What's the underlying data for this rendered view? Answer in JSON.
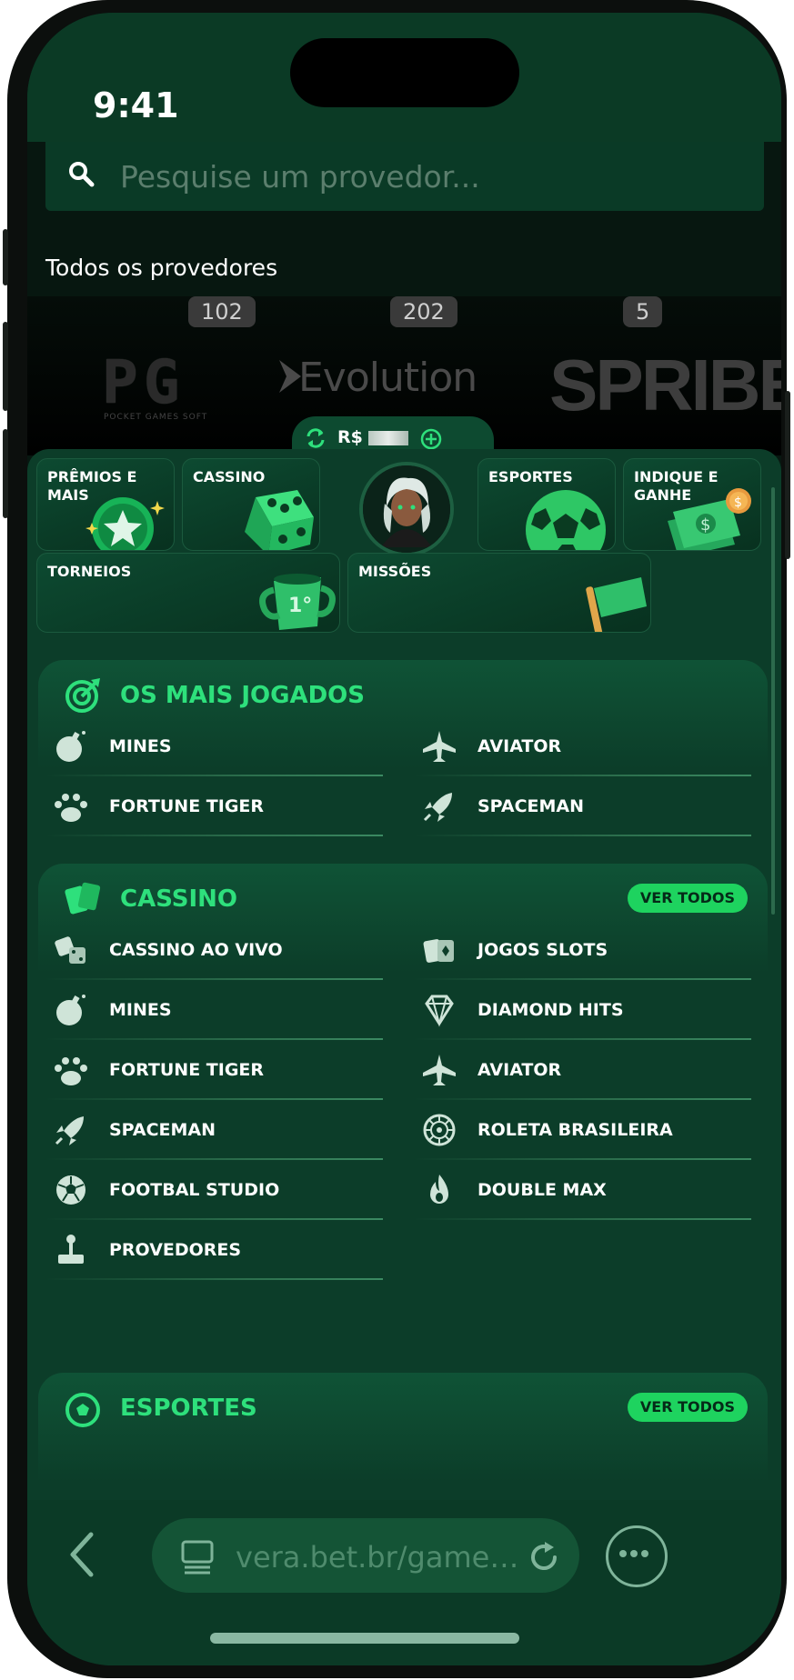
{
  "status_bar": {
    "time": "9:41"
  },
  "search": {
    "placeholder": "Pesquise um provedor..."
  },
  "providers": {
    "title": "Todos os provedores",
    "items": [
      {
        "name": "PG",
        "subtitle": "POCKET GAMES SOFT",
        "count": "102"
      },
      {
        "name": "Evolution",
        "count": "202"
      },
      {
        "name": "SPRIBE",
        "count": "5"
      }
    ]
  },
  "balance": {
    "currency": "R$"
  },
  "quick_tiles": [
    {
      "label": "PRÊMIOS E MAIS"
    },
    {
      "label": "CASSINO"
    },
    {
      "label": "ESPORTES"
    },
    {
      "label": "INDIQUE E GANHE"
    },
    {
      "label": "TORNEIOS"
    },
    {
      "label": "MISSÕES"
    }
  ],
  "sections": {
    "most_played": {
      "title": "OS MAIS JOGADOS",
      "items": [
        {
          "label": "MINES",
          "icon": "bomb-icon"
        },
        {
          "label": "AVIATOR",
          "icon": "airplane-icon"
        },
        {
          "label": "FORTUNE TIGER",
          "icon": "paw-icon"
        },
        {
          "label": "SPACEMAN",
          "icon": "rocket-icon"
        }
      ]
    },
    "cassino": {
      "title": "CASSINO",
      "see_all": "VER TODOS",
      "items": [
        {
          "label": "CASSINO AO VIVO",
          "icon": "dice-icon"
        },
        {
          "label": "JOGOS SLOTS",
          "icon": "cards-icon"
        },
        {
          "label": "MINES",
          "icon": "bomb-icon"
        },
        {
          "label": "DIAMOND HITS",
          "icon": "diamond-icon"
        },
        {
          "label": "FORTUNE TIGER",
          "icon": "paw-icon"
        },
        {
          "label": "AVIATOR",
          "icon": "airplane-icon"
        },
        {
          "label": "SPACEMAN",
          "icon": "rocket-icon"
        },
        {
          "label": "ROLETA BRASILEIRA",
          "icon": "roulette-icon"
        },
        {
          "label": "FOOTBAL STUDIO",
          "icon": "soccer-ball-icon"
        },
        {
          "label": "DOUBLE MAX",
          "icon": "flame-icon"
        },
        {
          "label": "PROVEDORES",
          "icon": "joystick-icon"
        }
      ]
    },
    "esportes": {
      "title": "ESPORTES",
      "see_all": "VER TODOS"
    }
  },
  "browser": {
    "url": "vera.bet.br/game…"
  },
  "colors": {
    "accent": "#2ee07c",
    "button": "#1ed35f",
    "background": "#0c3d29"
  }
}
